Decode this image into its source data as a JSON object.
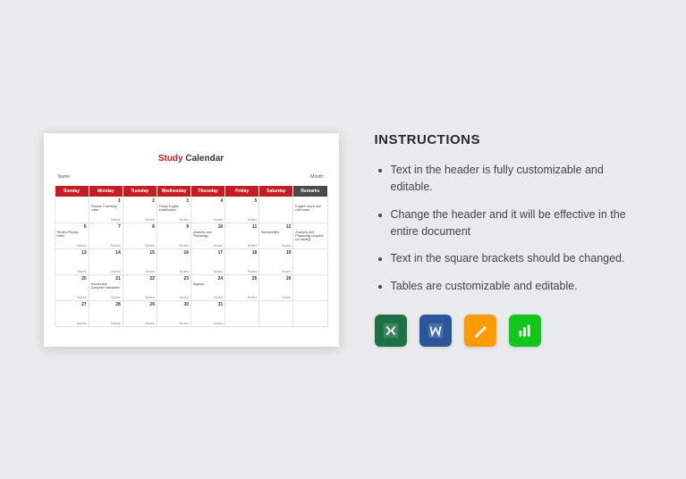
{
  "preview": {
    "title_study": "Study",
    "title_calendar": " Calendar",
    "meta_name": "Name:",
    "meta_month": "Month:",
    "headers": [
      "Sunday",
      "Monday",
      "Tuesday",
      "Wednesday",
      "Thursday",
      "Friday",
      "Saturday",
      "Remarks"
    ],
    "note_label": "Notes",
    "rows": [
      [
        {
          "n": "",
          "t": ""
        },
        {
          "n": "1",
          "t": "Prepare Chemistry notes"
        },
        {
          "n": "2",
          "t": ""
        },
        {
          "n": "3",
          "t": "Friday English examination"
        },
        {
          "n": "4",
          "t": ""
        },
        {
          "n": "5",
          "t": ""
        },
        {
          "n": "",
          "t": ""
        },
        {
          "n": "",
          "t": "English report due next week"
        }
      ],
      [
        {
          "n": "6",
          "t": "Review Physics notes"
        },
        {
          "n": "7",
          "t": ""
        },
        {
          "n": "8",
          "t": ""
        },
        {
          "n": "9",
          "t": ""
        },
        {
          "n": "10",
          "t": "Anatomy and Physiology"
        },
        {
          "n": "11",
          "t": ""
        },
        {
          "n": "12",
          "t": "Biochemistry"
        },
        {
          "n": "",
          "t": "Anatomy and Physiology chapters for reading"
        }
      ],
      [
        {
          "n": "13",
          "t": ""
        },
        {
          "n": "14",
          "t": ""
        },
        {
          "n": "15",
          "t": ""
        },
        {
          "n": "16",
          "t": ""
        },
        {
          "n": "17",
          "t": ""
        },
        {
          "n": "18",
          "t": ""
        },
        {
          "n": "19",
          "t": ""
        },
        {
          "n": "",
          "t": ""
        }
      ],
      [
        {
          "n": "20",
          "t": ""
        },
        {
          "n": "21",
          "t": "Human and Computer Interaction"
        },
        {
          "n": "22",
          "t": ""
        },
        {
          "n": "23",
          "t": ""
        },
        {
          "n": "24",
          "t": "Algebra"
        },
        {
          "n": "25",
          "t": ""
        },
        {
          "n": "26",
          "t": ""
        },
        {
          "n": "",
          "t": ""
        }
      ],
      [
        {
          "n": "27",
          "t": ""
        },
        {
          "n": "28",
          "t": ""
        },
        {
          "n": "29",
          "t": ""
        },
        {
          "n": "30",
          "t": ""
        },
        {
          "n": "31",
          "t": ""
        },
        {
          "n": "",
          "t": ""
        },
        {
          "n": "",
          "t": ""
        },
        {
          "n": "",
          "t": ""
        }
      ]
    ]
  },
  "instructions": {
    "heading": "INSTRUCTIONS",
    "bullets": [
      "Text in the header is fully customizable and editable.",
      "Change the header and it will be effective in the entire document",
      "Text in the square brackets should be changed.",
      "Tables are customizable and editable."
    ]
  },
  "icons": {
    "excel": "excel-icon",
    "word": "word-icon",
    "pages": "pages-icon",
    "numbers": "numbers-icon"
  }
}
